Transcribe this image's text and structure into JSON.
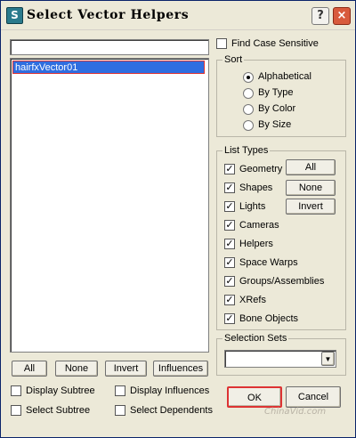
{
  "window": {
    "title": "Select Vector Helpers"
  },
  "titlebar": {
    "help": "?",
    "close": "×",
    "app_icon": "S"
  },
  "list": {
    "filter_value": "",
    "items": [
      "hairfxVector01"
    ]
  },
  "options": {
    "find_case_sensitive": "Find Case Sensitive"
  },
  "sort": {
    "title": "Sort",
    "options": [
      "Alphabetical",
      "By Type",
      "By Color",
      "By Size"
    ],
    "selected": "Alphabetical"
  },
  "list_types": {
    "title": "List Types",
    "items": [
      "Geometry",
      "Shapes",
      "Lights",
      "Cameras",
      "Helpers",
      "Space Warps",
      "Groups/Assemblies",
      "XRefs",
      "Bone Objects"
    ],
    "buttons": [
      "All",
      "None",
      "Invert"
    ]
  },
  "selection_sets": {
    "title": "Selection Sets",
    "value": ""
  },
  "bottom_buttons": [
    "All",
    "None",
    "Invert",
    "Influences"
  ],
  "checkboxes": [
    "Display Subtree",
    "Display Influences",
    "Select Subtree",
    "Select Dependents"
  ],
  "actions": {
    "ok": "OK",
    "cancel": "Cancel"
  },
  "watermark": "ChinaVid.com",
  "icons": {
    "checked_mark": "✓",
    "dropdown": "▼"
  }
}
